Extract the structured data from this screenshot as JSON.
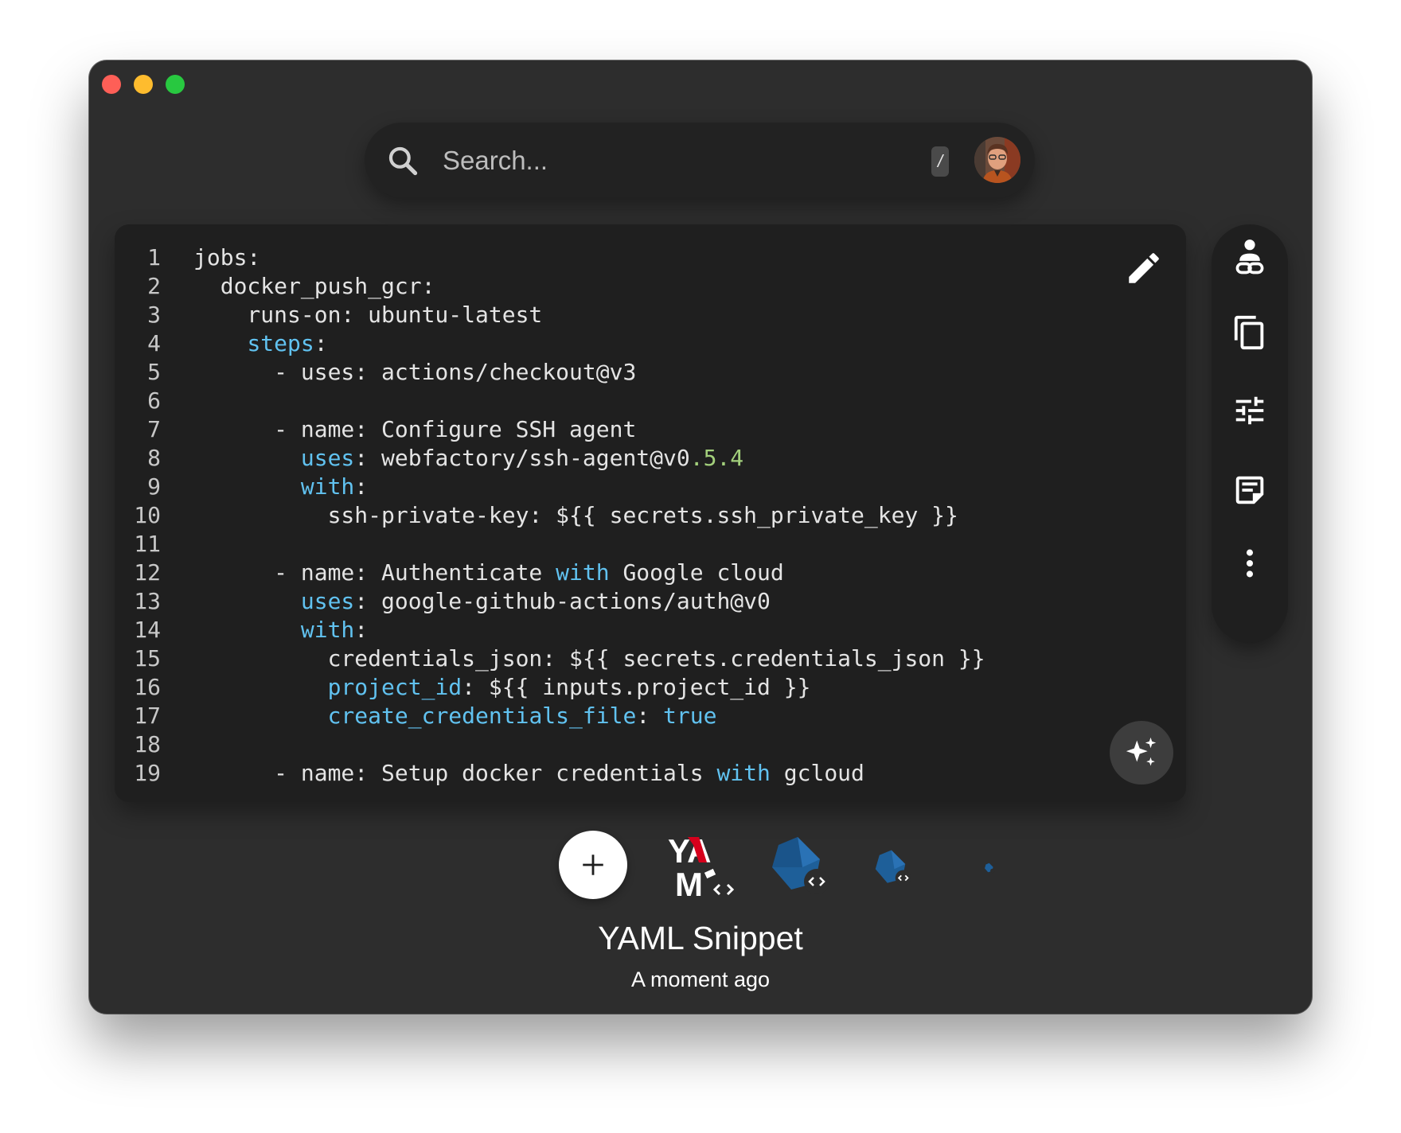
{
  "search": {
    "placeholder": "Search...",
    "shortcut": "/"
  },
  "editor": {
    "lines": [
      {
        "n": "1",
        "segs": [
          {
            "t": "jobs:"
          }
        ]
      },
      {
        "n": "2",
        "segs": [
          {
            "t": "  docker_push_gcr:"
          }
        ]
      },
      {
        "n": "3",
        "segs": [
          {
            "t": "    runs-on: ubuntu-latest"
          }
        ]
      },
      {
        "n": "4",
        "segs": [
          {
            "t": "    "
          },
          {
            "t": "steps",
            "c": "kw"
          },
          {
            "t": ":"
          }
        ]
      },
      {
        "n": "5",
        "segs": [
          {
            "t": "      - uses: actions/checkout@v3"
          }
        ]
      },
      {
        "n": "6",
        "segs": [
          {
            "t": ""
          }
        ]
      },
      {
        "n": "7",
        "segs": [
          {
            "t": "      - name: Configure SSH agent"
          }
        ]
      },
      {
        "n": "8",
        "segs": [
          {
            "t": "        "
          },
          {
            "t": "uses",
            "c": "kw"
          },
          {
            "t": ": webfactory/ssh-agent@v0"
          },
          {
            "t": ".5.4",
            "c": "num"
          }
        ]
      },
      {
        "n": "9",
        "segs": [
          {
            "t": "        "
          },
          {
            "t": "with",
            "c": "kw"
          },
          {
            "t": ":"
          }
        ]
      },
      {
        "n": "10",
        "segs": [
          {
            "t": "          ssh-private-key: ${{ secrets.ssh_private_key }}"
          }
        ]
      },
      {
        "n": "11",
        "segs": [
          {
            "t": ""
          }
        ]
      },
      {
        "n": "12",
        "segs": [
          {
            "t": "      - name: Authenticate "
          },
          {
            "t": "with",
            "c": "kw"
          },
          {
            "t": " Google cloud"
          }
        ]
      },
      {
        "n": "13",
        "segs": [
          {
            "t": "        "
          },
          {
            "t": "uses",
            "c": "kw"
          },
          {
            "t": ": google-github-actions/auth@v0"
          }
        ]
      },
      {
        "n": "14",
        "segs": [
          {
            "t": "        "
          },
          {
            "t": "with",
            "c": "kw"
          },
          {
            "t": ":"
          }
        ]
      },
      {
        "n": "15",
        "segs": [
          {
            "t": "          credentials_json: ${{ secrets.credentials_json }}"
          }
        ]
      },
      {
        "n": "16",
        "segs": [
          {
            "t": "          "
          },
          {
            "t": "project_id",
            "c": "kw"
          },
          {
            "t": ": ${{ inputs.project_id }}"
          }
        ]
      },
      {
        "n": "17",
        "segs": [
          {
            "t": "          "
          },
          {
            "t": "create_credentials_file",
            "c": "kw"
          },
          {
            "t": ": "
          },
          {
            "t": "true",
            "c": "kw"
          }
        ]
      },
      {
        "n": "18",
        "segs": [
          {
            "t": ""
          }
        ]
      },
      {
        "n": "19",
        "segs": [
          {
            "t": "      - name: Setup docker credentials "
          },
          {
            "t": "with",
            "c": "kw"
          },
          {
            "t": " gcloud"
          }
        ]
      }
    ]
  },
  "toolbar": {
    "icons": [
      "person-link-icon",
      "copy-icon",
      "tune-icon",
      "note-icon",
      "more-vert-icon"
    ]
  },
  "assets": {
    "yaml_logo_top": "YA",
    "yaml_logo_bottom": "M"
  },
  "snippet": {
    "title": "YAML Snippet",
    "timestamp": "A moment ago"
  },
  "colors": {
    "keyword": "#61c2f0",
    "number": "#a3d07c",
    "window_bg": "#2d2d2d",
    "editor_bg": "#1f1f1f"
  }
}
